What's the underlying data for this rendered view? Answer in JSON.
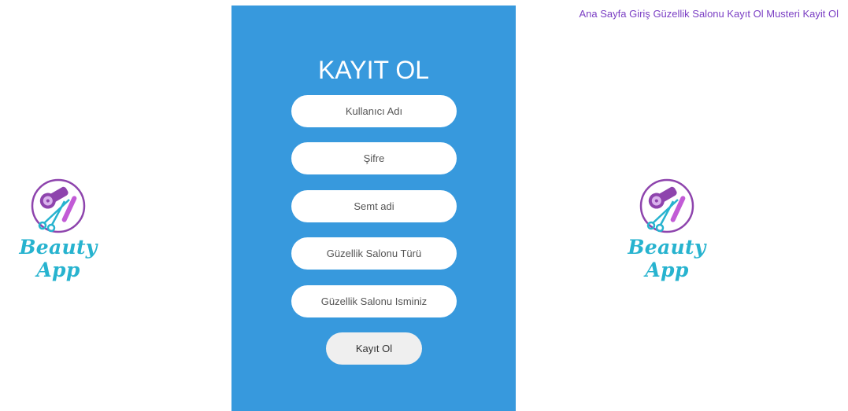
{
  "nav": {
    "links": [
      "Ana Sayfa",
      "Giriş",
      "Güzellik Salonu Kayıt Ol",
      "Musteri Kayit Ol"
    ]
  },
  "brand": {
    "name": "Beauty App",
    "icon": "hairdryer-scissors-comb-icon"
  },
  "form": {
    "title": "KAYIT OL",
    "fields": {
      "username_placeholder": "Kullanıcı Adı",
      "password_placeholder": "Şifre",
      "district_placeholder": "Semt adi",
      "salon_type_placeholder": "Güzellik Salonu Türü",
      "salon_name_placeholder": "Güzellik Salonu Isminiz"
    },
    "submit_label": "Kayıt Ol"
  },
  "colors": {
    "panel": "#3799dd",
    "nav_link": "#7b3fc4",
    "brand_text": "#27b3cf",
    "logo_purple": "#8e44ad"
  }
}
